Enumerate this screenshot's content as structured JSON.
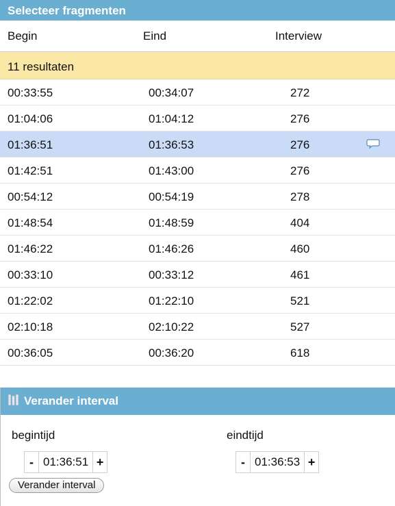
{
  "header": {
    "title": "Selecteer fragmenten"
  },
  "columns": {
    "begin": "Begin",
    "eind": "Eind",
    "interview": "Interview"
  },
  "results_label": "11 resultaten",
  "rows": [
    {
      "begin": "00:33:55",
      "eind": "00:34:07",
      "interview": "272",
      "selected": false
    },
    {
      "begin": "01:04:06",
      "eind": "01:04:12",
      "interview": "276",
      "selected": false
    },
    {
      "begin": "01:36:51",
      "eind": "01:36:53",
      "interview": "276",
      "selected": true,
      "icon": "speech-bubble-icon"
    },
    {
      "begin": "01:42:51",
      "eind": "01:43:00",
      "interview": "276",
      "selected": false
    },
    {
      "begin": "00:54:12",
      "eind": "00:54:19",
      "interview": "278",
      "selected": false
    },
    {
      "begin": "01:48:54",
      "eind": "01:48:59",
      "interview": "404",
      "selected": false
    },
    {
      "begin": "01:46:22",
      "eind": "01:46:26",
      "interview": "460",
      "selected": false
    },
    {
      "begin": "00:33:10",
      "eind": "00:33:12",
      "interview": "461",
      "selected": false
    },
    {
      "begin": "01:22:02",
      "eind": "01:22:10",
      "interview": "521",
      "selected": false
    },
    {
      "begin": "02:10:18",
      "eind": "02:10:22",
      "interview": "527",
      "selected": false
    },
    {
      "begin": "00:36:05",
      "eind": "00:36:20",
      "interview": "618",
      "selected": false
    }
  ],
  "interval": {
    "title": "Verander interval",
    "icon": "book-stack-icon",
    "begintijd_label": "begintijd",
    "eindtijd_label": "eindtijd",
    "begintijd_value": "01:36:51",
    "eindtijd_value": "01:36:53",
    "minus": "-",
    "plus": "+",
    "apply_label": "Verander interval"
  },
  "colors": {
    "header_bg": "#6aaed2",
    "results_bg": "#fbe8a6",
    "selected_row_bg": "#c9dbf6"
  }
}
